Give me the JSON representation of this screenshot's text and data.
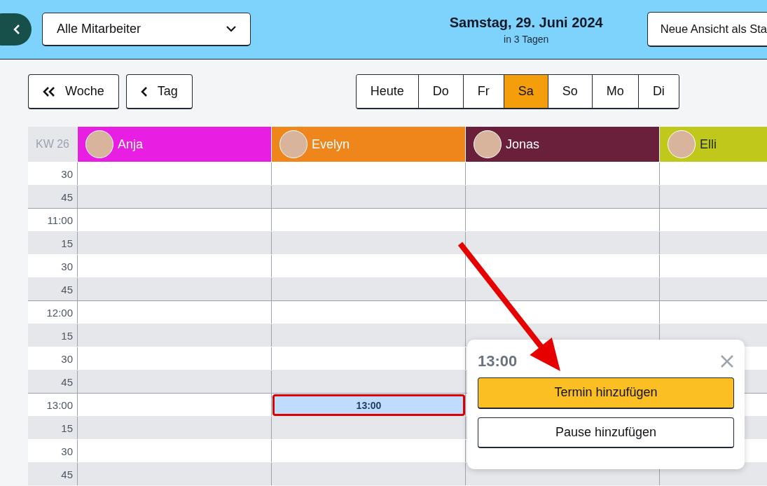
{
  "header": {
    "filter": {
      "value": "Alle Mitarbeiter"
    },
    "date": "Samstag, 29. Juni 2024",
    "relative": "in 3 Tagen",
    "save_view_button": "Neue Ansicht als Sta"
  },
  "nav": {
    "back_buttons": [
      {
        "label": "Woche",
        "kind": "double"
      },
      {
        "label": "Tag",
        "kind": "single"
      }
    ],
    "days": [
      {
        "label": "Heute",
        "selected": false
      },
      {
        "label": "Do",
        "selected": false
      },
      {
        "label": "Fr",
        "selected": false
      },
      {
        "label": "Sa",
        "selected": true
      },
      {
        "label": "So",
        "selected": false
      },
      {
        "label": "Mo",
        "selected": false
      },
      {
        "label": "Di",
        "selected": false
      }
    ]
  },
  "calendar": {
    "week": "KW 26",
    "employees": [
      {
        "name": "Anja",
        "color": "#e81ee3"
      },
      {
        "name": "Evelyn",
        "color": "#ef861c"
      },
      {
        "name": "Jonas",
        "color": "#6a1f3a"
      },
      {
        "name": "Elli",
        "color": "#c0c81b"
      }
    ],
    "rows": [
      {
        "time": "30",
        "kind": "quarter"
      },
      {
        "time": "45",
        "kind": "quarter"
      },
      {
        "time": "11:00",
        "kind": "hour"
      },
      {
        "time": "15",
        "kind": "quarter"
      },
      {
        "time": "30",
        "kind": "quarter"
      },
      {
        "time": "45",
        "kind": "quarter"
      },
      {
        "time": "12:00",
        "kind": "hour"
      },
      {
        "time": "15",
        "kind": "quarter"
      },
      {
        "time": "30",
        "kind": "quarter"
      },
      {
        "time": "45",
        "kind": "quarter"
      },
      {
        "time": "13:00",
        "kind": "hour",
        "cells": [
          {
            "selected": false
          },
          {
            "selected": true,
            "label": "13:00"
          }
        ]
      },
      {
        "time": "15",
        "kind": "quarter"
      },
      {
        "time": "30",
        "kind": "quarter"
      },
      {
        "time": "45",
        "kind": "quarter"
      }
    ]
  },
  "popover": {
    "title": "13:00",
    "buttons": [
      {
        "label": "Termin hinzufügen",
        "kind": "primary"
      },
      {
        "label": "Pause hinzufügen",
        "kind": "secondary"
      }
    ]
  }
}
